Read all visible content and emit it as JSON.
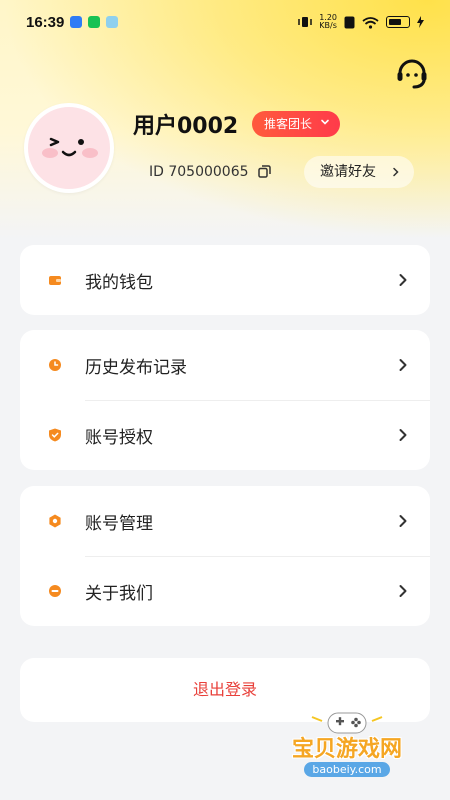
{
  "status_bar": {
    "time": "16:39",
    "net_speed_value": "1.20",
    "net_speed_unit": "KB/s"
  },
  "profile": {
    "username": "用户0002",
    "role_badge": "推客团长",
    "id_text": "ID 705000065",
    "invite_label": "邀请好友"
  },
  "menu": {
    "group1": [
      {
        "label": "我的钱包",
        "icon": "wallet-icon",
        "color": "#f58a1f"
      }
    ],
    "group2": [
      {
        "label": "历史发布记录",
        "icon": "clock-icon",
        "color": "#f58a1f"
      },
      {
        "label": "账号授权",
        "icon": "shield-check-icon",
        "color": "#f58a1f"
      }
    ],
    "group3": [
      {
        "label": "账号管理",
        "icon": "settings-icon",
        "color": "#f58a1f"
      },
      {
        "label": "关于我们",
        "icon": "info-icon",
        "color": "#f58a1f"
      }
    ]
  },
  "logout_label": "退出登录",
  "watermark": {
    "title": "宝贝游戏网",
    "url": "baobeiy.com"
  },
  "colors": {
    "accent": "#f58a1f",
    "badge": "#ff4545",
    "logout": "#e8403a",
    "header_yellow": "#ffe14a"
  }
}
